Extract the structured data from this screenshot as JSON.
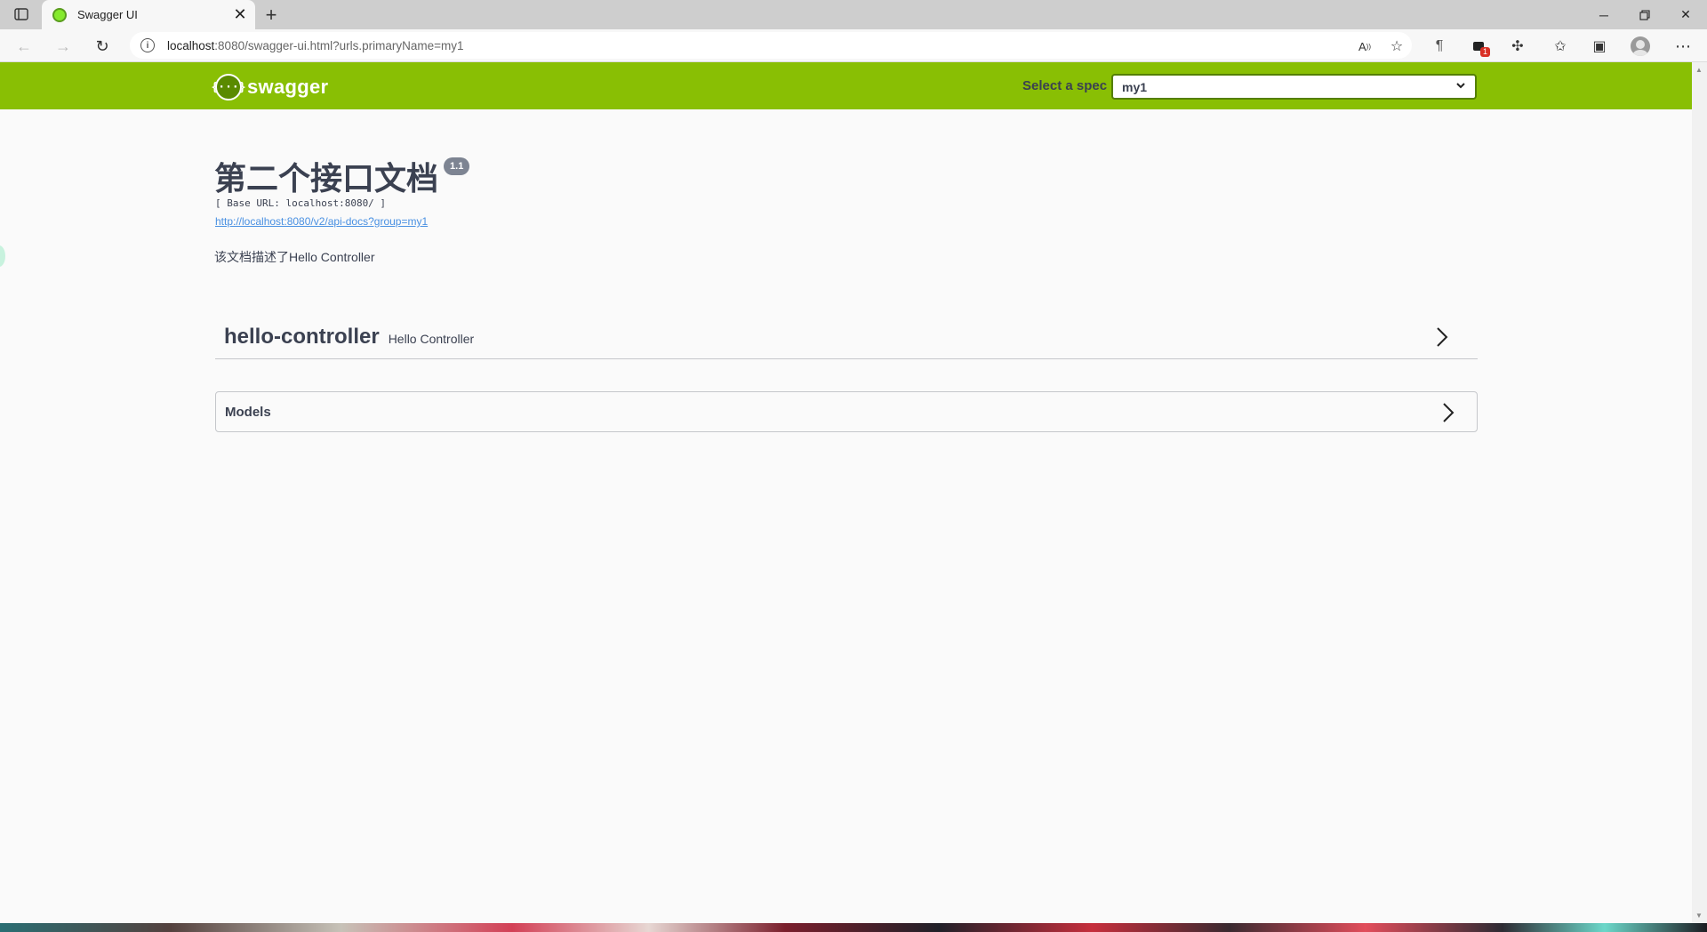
{
  "browser": {
    "tab_title": "Swagger UI",
    "url_host": "localhost",
    "url_rest": ":8080/swagger-ui.html?urls.primaryName=my1",
    "extension_badge": "1"
  },
  "topbar": {
    "logo_mark": "{···}",
    "logo_text": "swagger",
    "spec_label": "Select a spec",
    "spec_selected": "my1"
  },
  "info": {
    "title": "第二个接口文档",
    "version": "1.1",
    "base_url": "[ Base URL: localhost:8080/ ]",
    "api_docs_link": "http://localhost:8080/v2/api-docs?group=my1",
    "description": "该文档描述了Hello Controller"
  },
  "tags": [
    {
      "name": "hello-controller",
      "description": "Hello Controller"
    }
  ],
  "models": {
    "label": "Models"
  },
  "colors": {
    "topbar": "#89bf04",
    "text": "#3b4151",
    "link": "#4990e2"
  }
}
